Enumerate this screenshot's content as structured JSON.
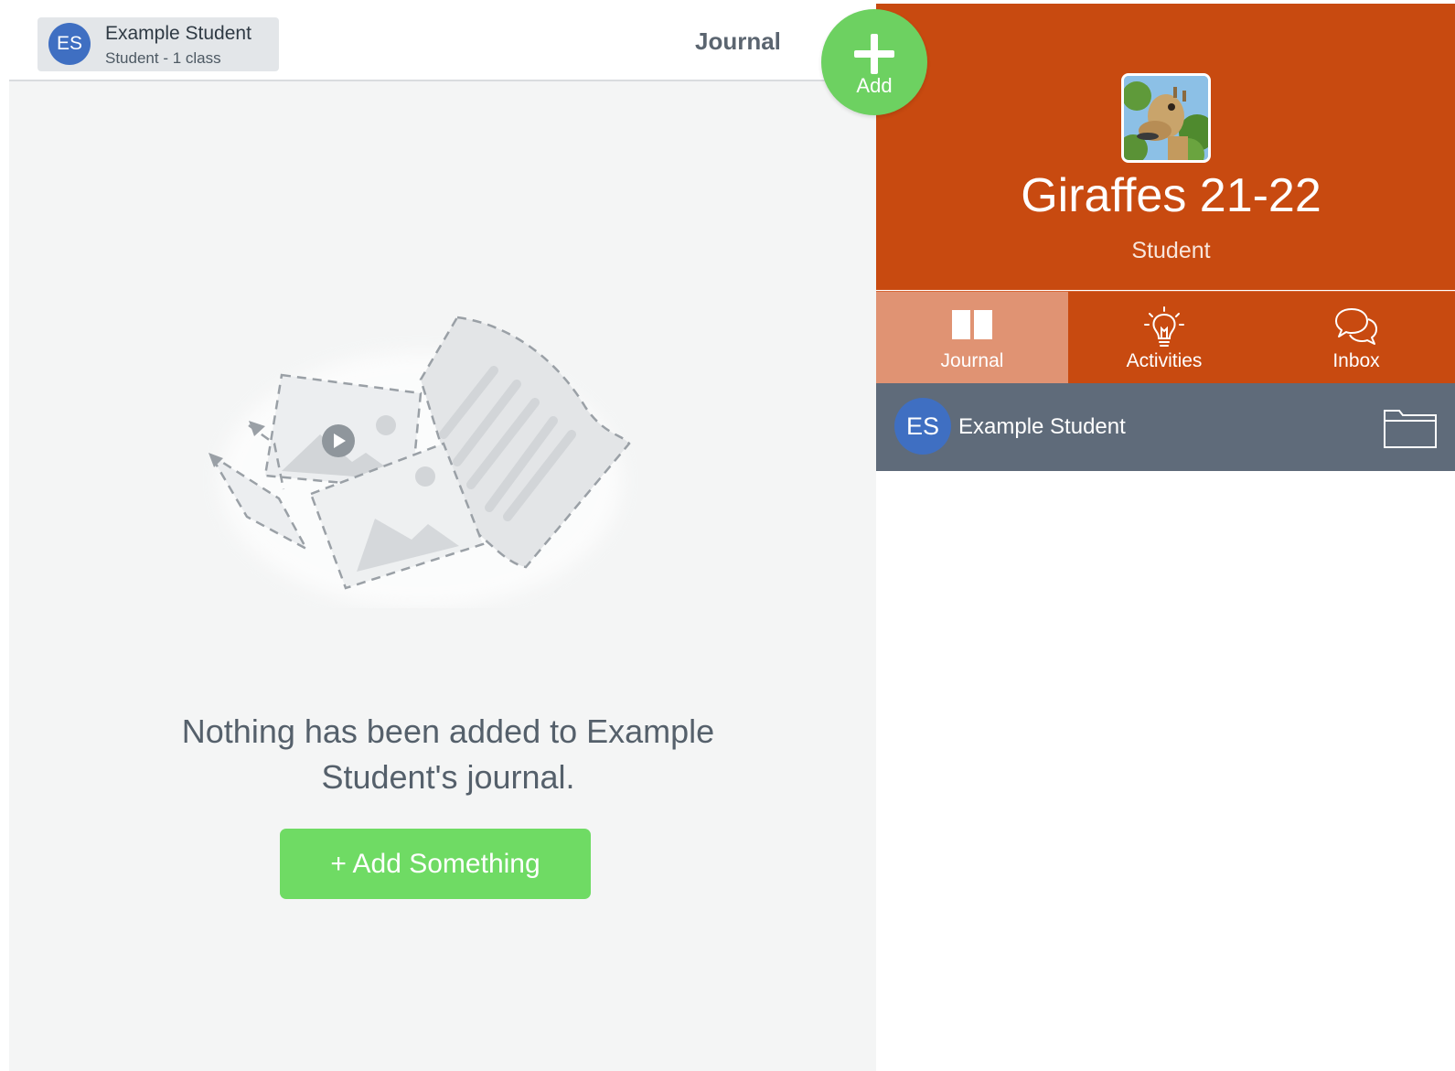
{
  "topbar": {
    "student": {
      "initials": "ES",
      "name": "Example Student",
      "subtitle": "Student - 1 class"
    },
    "title": "Journal"
  },
  "empty_state": {
    "message": "Nothing has been added to Example Student's journal.",
    "button_label": "+ Add Something"
  },
  "fab": {
    "label": "Add"
  },
  "class_panel": {
    "name": "Giraffes 21-22",
    "role": "Student",
    "tabs": [
      {
        "label": "Journal",
        "icon": "book-icon",
        "active": true
      },
      {
        "label": "Activities",
        "icon": "lightbulb-icon",
        "active": false
      },
      {
        "label": "Inbox",
        "icon": "chat-bubbles-icon",
        "active": false
      }
    ],
    "student_row": {
      "initials": "ES",
      "name": "Example Student"
    }
  },
  "colors": {
    "class_header": "#c84a10",
    "active_tab": "#e09373",
    "add_green": "#6fdb64",
    "avatar_blue": "#3f6fc2",
    "student_row": "#5f6b7a"
  }
}
